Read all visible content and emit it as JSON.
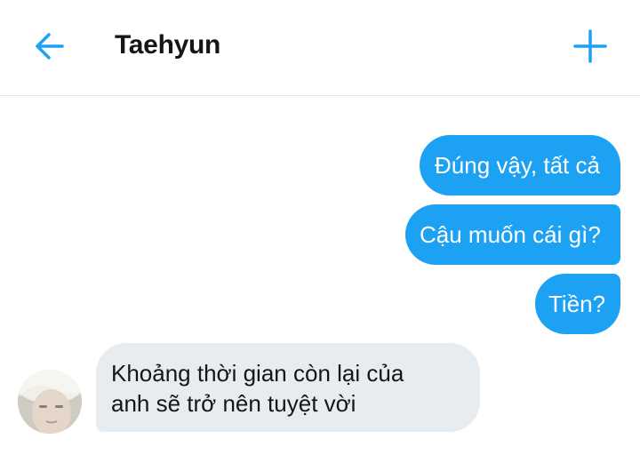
{
  "header": {
    "title": "Taehyun",
    "back_icon": "arrow-left-icon",
    "new_icon": "plus-icon"
  },
  "messages": [
    {
      "sender": "me",
      "text": "Đúng vậy, tất cả"
    },
    {
      "sender": "me",
      "text": "Cậu muốn cái gì?"
    },
    {
      "sender": "me",
      "text": "Tiền?"
    },
    {
      "sender": "Taehyun",
      "lines": [
        "Khoảng thời gian còn lại của",
        "anh sẽ trở nên tuyệt vời"
      ]
    }
  ],
  "colors": {
    "accent": "#1da1f2",
    "received_bubble": "#e6ecf0",
    "text": "#14171a"
  }
}
